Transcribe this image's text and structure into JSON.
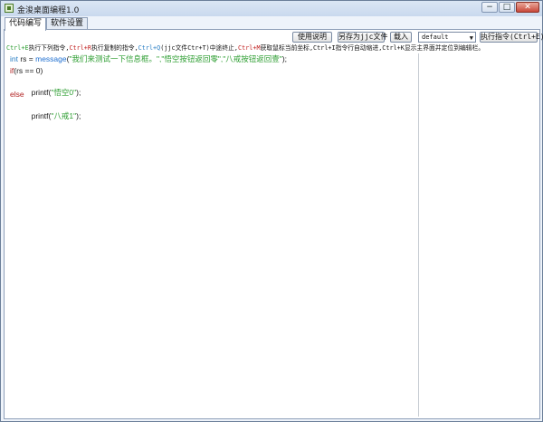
{
  "window": {
    "title": "金浚桌面编程1.0"
  },
  "title_buttons": {
    "min": "−",
    "max": "□",
    "close": "✕"
  },
  "tabs": [
    {
      "label": "代码编写",
      "active": true
    },
    {
      "label": "软件设置",
      "active": false
    }
  ],
  "toolbar": {
    "instructions": "使用说明",
    "save_as": "另存为jjc文件",
    "load": "载入",
    "select_value": "default",
    "execute": "执行指令(Ctrl+E)"
  },
  "hint": [
    {
      "text": "Ctrl+E",
      "color": "green"
    },
    {
      "text": "执行下列指令,",
      "color": "plain"
    },
    {
      "text": "Ctrl+R",
      "color": "red"
    },
    {
      "text": "执行复制的指令,",
      "color": "plain"
    },
    {
      "text": "Ctrl+Q",
      "color": "blue"
    },
    {
      "text": "(jjc文件Ctr+T)中途终止,",
      "color": "plain"
    },
    {
      "text": "Ctrl+M",
      "color": "red"
    },
    {
      "text": "获取鼠标当前坐标,Ctrl+I指令行自动缩进,Ctrl+K显示主界面并定位到编辑栏。",
      "color": "plain"
    }
  ],
  "code": [
    [
      {
        "t": "int",
        "c": "type"
      },
      {
        "t": " rs = ",
        "c": "plain"
      },
      {
        "t": "message",
        "c": "fn"
      },
      {
        "t": "(",
        "c": "plain"
      },
      {
        "t": "\"我们来测试一下信息框。\",\"悟空按钮返回零\",\"八戒按钮返回壹\"",
        "c": "str"
      },
      {
        "t": ");",
        "c": "plain"
      }
    ],
    [
      {
        "t": "if",
        "c": "kw"
      },
      {
        "t": "(rs == 0)",
        "c": "plain"
      }
    ],
    [
      {
        "t": "    printf(",
        "c": "plain"
      },
      {
        "t": "\"悟空0\"",
        "c": "str"
      },
      {
        "t": ");",
        "c": "plain"
      }
    ],
    [
      {
        "t": "else",
        "c": "kw"
      }
    ],
    [
      {
        "t": "    printf(",
        "c": "plain"
      },
      {
        "t": "\"八戒1\"",
        "c": "str"
      },
      {
        "t": ");",
        "c": "plain"
      }
    ]
  ]
}
